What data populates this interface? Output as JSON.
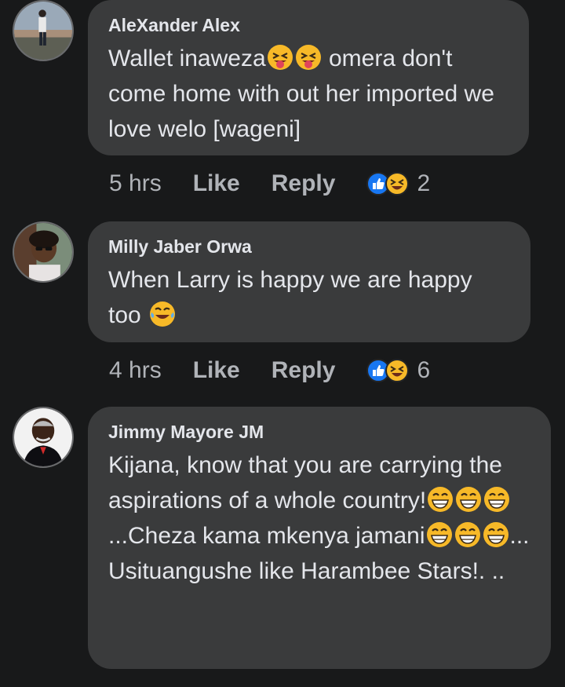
{
  "comments": [
    {
      "author": "AleXander Alex",
      "text_parts": [
        "Wallet inaweza",
        " omera don't come home with out her imported we love welo [wageni]"
      ],
      "time": "5 hrs",
      "like_label": "Like",
      "reply_label": "Reply",
      "reaction_count": "2",
      "reaction_icons": [
        "like-icon",
        "laugh-icon"
      ]
    },
    {
      "author": "Milly Jaber Orwa",
      "text": "When Larry is happy we are happy too",
      "time": "4 hrs",
      "like_label": "Like",
      "reply_label": "Reply",
      "reaction_count": "6",
      "reaction_icons": [
        "like-icon",
        "laugh-icon"
      ]
    },
    {
      "author": "Jimmy Mayore JM",
      "text_parts": [
        "Kijana, know that you are carrying the aspirations of a whole country!",
        "...Cheza kama mkenya jamani",
        "... Usituangushe like Harambee Stars!. .."
      ]
    }
  ],
  "colors": {
    "background": "#18191a",
    "bubble": "#3a3b3c",
    "text": "#e4e6eb",
    "secondary_text": "#b0b3b8",
    "like_blue": "#1877f2",
    "emoji_yellow": "#f7b928"
  }
}
